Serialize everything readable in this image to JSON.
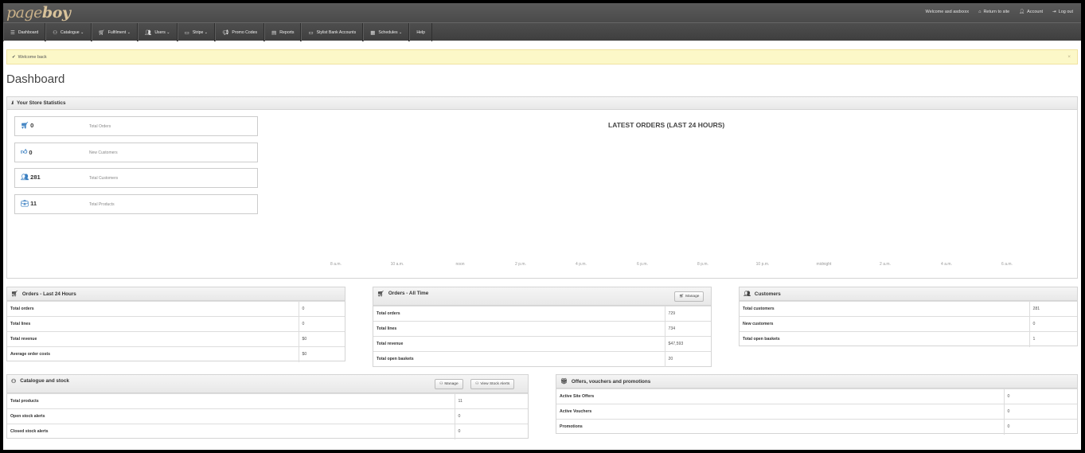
{
  "brand": {
    "prefix": "page",
    "suffix": "boy"
  },
  "toplinks": [
    {
      "label": "Welcome asd asdxxxx",
      "icon": ""
    },
    {
      "label": "Return to site",
      "icon": "home-icon"
    },
    {
      "label": "Account",
      "icon": "user-icon"
    },
    {
      "label": "Log out",
      "icon": "logout-icon"
    }
  ],
  "nav": [
    {
      "label": "Dashboard",
      "icon": "list-icon"
    },
    {
      "label": "Catalogue ⌄",
      "icon": "sitemap-icon"
    },
    {
      "label": "Fulfilment ⌄",
      "icon": "cart-icon"
    },
    {
      "label": "Users ⌄",
      "icon": "group-icon"
    },
    {
      "label": "Stripe ⌄",
      "icon": "card-icon"
    },
    {
      "label": "Promo Codes",
      "icon": "bullhorn-icon"
    },
    {
      "label": "Reports",
      "icon": "chart-icon"
    },
    {
      "label": "Stylist Bank Accounts",
      "icon": "card-icon"
    },
    {
      "label": "Schedules ⌄",
      "icon": "calendar-icon"
    },
    {
      "label": "Help",
      "icon": ""
    }
  ],
  "alert": {
    "text": "Welcome back",
    "close": "×"
  },
  "page_title": "Dashboard",
  "stats": {
    "title": "Your Store Statistics",
    "boxes": [
      {
        "value": "0",
        "label": "Total Orders",
        "icon": "cart-icon"
      },
      {
        "value": "0",
        "label": "New Customers",
        "icon": "thumbs-up-icon"
      },
      {
        "value": "281",
        "label": "Total Customers",
        "icon": "group-icon"
      },
      {
        "value": "11",
        "label": "Total Products",
        "icon": "briefcase-icon"
      }
    ],
    "chart_title": "LATEST ORDERS (LAST 24 HOURS)",
    "ticks": [
      "8 a.m.",
      "10 a.m.",
      "noon",
      "2 p.m.",
      "4 p.m.",
      "6 p.m.",
      "8 p.m.",
      "10 p.m.",
      "midnight",
      "2 a.m.",
      "4 a.m.",
      "6 a.m."
    ]
  },
  "orders24": {
    "title": "Orders - Last 24 Hours",
    "rows": [
      {
        "label": "Total orders",
        "value": "0"
      },
      {
        "label": "Total lines",
        "value": "0"
      },
      {
        "label": "Total revenue",
        "value": "$0"
      },
      {
        "label": "Average order costs",
        "value": "$0"
      }
    ]
  },
  "ordersAll": {
    "title": "Orders - All Time",
    "button": "Manage",
    "rows": [
      {
        "label": "Total orders",
        "value": "729"
      },
      {
        "label": "Total lines",
        "value": "734"
      },
      {
        "label": "Total revenue",
        "value": "$47,593"
      },
      {
        "label": "Total open baskets",
        "value": "20"
      }
    ]
  },
  "customers": {
    "title": "Customers",
    "rows": [
      {
        "label": "Total customers",
        "value": "281"
      },
      {
        "label": "New customers",
        "value": "0"
      },
      {
        "label": "Total open baskets",
        "value": "1"
      }
    ]
  },
  "catalogue": {
    "title": "Catalogue and stock",
    "manage": "Manage",
    "alerts": "View Stock Alerts",
    "rows": [
      {
        "label": "Total products",
        "value": "11"
      },
      {
        "label": "Open stock alerts",
        "value": "0"
      },
      {
        "label": "Closed stock alerts",
        "value": "0"
      }
    ]
  },
  "offers": {
    "title": "Offers, vouchers and promotions",
    "rows": [
      {
        "label": "Active Site Offers",
        "value": "0"
      },
      {
        "label": "Active Vouchers",
        "value": "0"
      },
      {
        "label": "Promotions",
        "value": "0"
      }
    ]
  }
}
